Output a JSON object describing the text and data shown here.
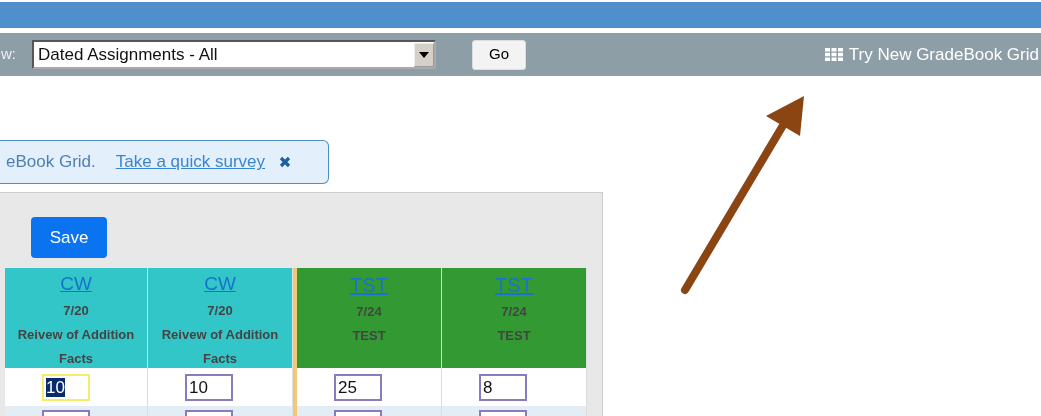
{
  "toolbar": {
    "view_label": "w:",
    "view_select": {
      "value": "Dated Assignments - All"
    },
    "go_button": "Go",
    "try_link": "Try New GradeBook Grid"
  },
  "banner": {
    "text": "eBook Grid.",
    "link": "Take a quick survey"
  },
  "save_button": "Save",
  "table": {
    "columns": [
      {
        "category": "CW",
        "date": "7/20",
        "description": "Reivew of Addition Facts",
        "color": "#33c6c9"
      },
      {
        "category": "CW",
        "date": "7/20",
        "description": "Reivew of Addition Facts",
        "color": "#33c6c9"
      },
      {
        "category": "TST",
        "date": "7/24",
        "description": "TEST",
        "color": "#339933"
      },
      {
        "category": "TST",
        "date": "7/24",
        "description": "TEST",
        "color": "#339933"
      }
    ],
    "rows": [
      {
        "cells": [
          {
            "value": "10",
            "focused": true
          },
          {
            "value": "10",
            "focused": false
          },
          {
            "value": "25",
            "focused": false
          },
          {
            "value": "8",
            "focused": false
          }
        ]
      },
      {
        "cells": [
          {
            "focused": false
          },
          {
            "focused": false
          },
          {
            "focused": false
          },
          {
            "focused": false
          }
        ]
      }
    ]
  }
}
